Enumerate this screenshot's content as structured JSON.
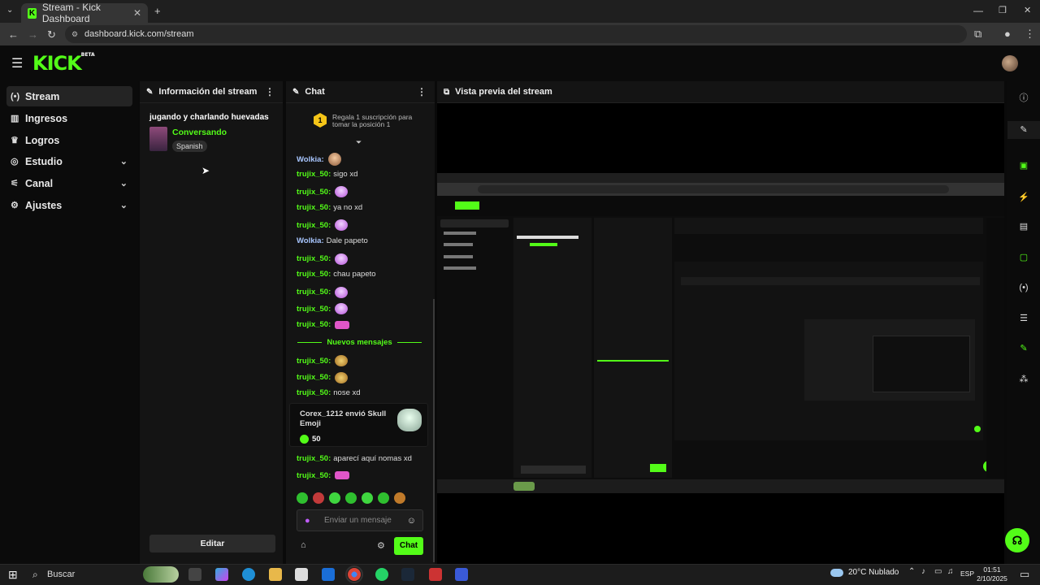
{
  "browser": {
    "tab_title": "Stream - Kick Dashboard",
    "url": "dashboard.kick.com/stream"
  },
  "brand": {
    "logo": "KICK",
    "badge": "BETA"
  },
  "nav": {
    "items": [
      {
        "label": "Stream",
        "icon": "broadcast-icon",
        "active": true
      },
      {
        "label": "Ingresos",
        "icon": "chart-icon"
      },
      {
        "label": "Logros",
        "icon": "trophy-icon"
      },
      {
        "label": "Estudio",
        "icon": "studio-icon",
        "expandable": true
      },
      {
        "label": "Canal",
        "icon": "channel-icon",
        "expandable": true
      },
      {
        "label": "Ajustes",
        "icon": "gear-icon",
        "expandable": true
      }
    ]
  },
  "info_panel": {
    "title": "Información del stream",
    "stream_title": "jugando y charlando huevadas",
    "category": "Conversando",
    "language": "Spanish",
    "edit_label": "Editar"
  },
  "chat_panel": {
    "title": "Chat",
    "gift_rank": "1",
    "gift_text": "Regala 1 suscripción para tomar la posición 1",
    "messages": [
      {
        "user": "Wolkia:",
        "text": "",
        "emote": "face",
        "user_color": "blue"
      },
      {
        "user": "trujix_50:",
        "text": "sigo xd"
      },
      {
        "user": "trujix_50:",
        "text": "",
        "emote": "pink"
      },
      {
        "user": "trujix_50:",
        "text": "ya no xd"
      },
      {
        "user": "trujix_50:",
        "text": "",
        "emote": "pink"
      },
      {
        "user": "Wolkia:",
        "text": "Dale papeto",
        "user_color": "blue"
      },
      {
        "user": "trujix_50:",
        "text": "",
        "emote": "pink"
      },
      {
        "user": "trujix_50:",
        "text": "chau papeto"
      },
      {
        "user": "trujix_50:",
        "text": "",
        "emote": "pink"
      },
      {
        "user": "trujix_50:",
        "text": "",
        "emote": "pink"
      },
      {
        "user": "trujix_50:",
        "text": "",
        "emote": "bow"
      }
    ],
    "new_messages_label": "Nuevos mensajes",
    "messages_after": [
      {
        "user": "trujix_50:",
        "text": "",
        "emote": "mon"
      },
      {
        "user": "trujix_50:",
        "text": "",
        "emote": "mon"
      },
      {
        "user": "trujix_50:",
        "text": "nose xd"
      }
    ],
    "gift_card": {
      "text": "Corex_1212 envió Skull Emoji",
      "amount": "50"
    },
    "messages_late": [
      {
        "user": "trujix_50:",
        "text": "aparecí aquí nomas xd"
      },
      {
        "user": "trujix_50:",
        "text": "",
        "emote": "bow"
      }
    ],
    "input_placeholder": "Enviar un mensaje",
    "send_label": "Chat"
  },
  "preview_panel": {
    "title": "Vista previa del stream"
  },
  "taskbar": {
    "search_label": "Buscar",
    "weather": "20°C Nublado",
    "language": "ESP",
    "time": "01:51",
    "date": "2/10/2025"
  },
  "colors": {
    "accent": "#53fc18",
    "panel": "#141414",
    "background": "#0a0a0a"
  }
}
